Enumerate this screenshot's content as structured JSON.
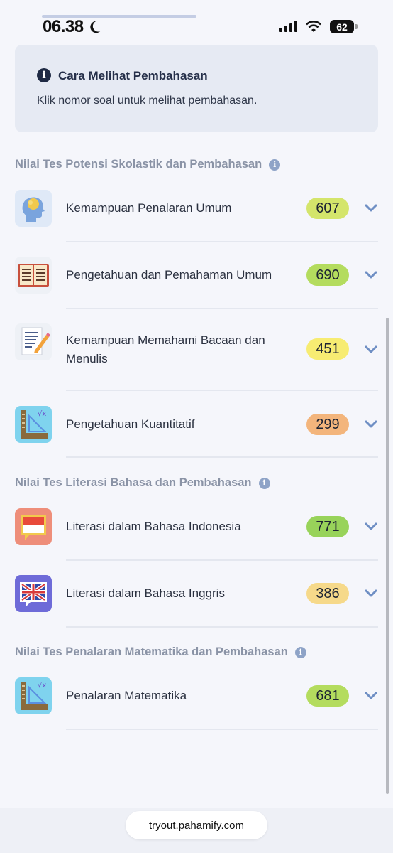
{
  "status_bar": {
    "time": "06.38",
    "battery": "62"
  },
  "info_box": {
    "title": "Cara Melihat Pembahasan",
    "text": "Klik nomor soal untuk melihat pembahasan."
  },
  "sections": [
    {
      "heading": "Nilai Tes Potensi Skolastik dan Pembahasan",
      "items": [
        {
          "label": "Kemampuan Penalaran Umum",
          "score": "607",
          "icon": "head-brain-icon",
          "score_color": "#d4e56b"
        },
        {
          "label": "Pengetahuan dan Pemahaman Umum",
          "score": "690",
          "icon": "open-book-icon",
          "score_color": "#b4dc5e"
        },
        {
          "label": "Kemampuan Memahami Bacaan dan Menulis",
          "score": "451",
          "icon": "document-pencil-icon",
          "score_color": "#f7ec72"
        },
        {
          "label": "Pengetahuan Kuantitatif",
          "score": "299",
          "icon": "ruler-math-icon",
          "score_color": "#f3b57c"
        }
      ]
    },
    {
      "heading": "Nilai Tes Literasi Bahasa dan Pembahasan",
      "items": [
        {
          "label": "Literasi dalam Bahasa Indonesia",
          "score": "771",
          "icon": "indonesia-flag-chat-icon",
          "score_color": "#98d35a"
        },
        {
          "label": "Literasi dalam Bahasa Inggris",
          "score": "386",
          "icon": "uk-flag-chat-icon",
          "score_color": "#f6d98a"
        }
      ]
    },
    {
      "heading": "Nilai Tes Penalaran Matematika dan Pembahasan",
      "items": [
        {
          "label": "Penalaran Matematika",
          "score": "681",
          "icon": "ruler-math-icon",
          "score_color": "#b4dc5e"
        }
      ]
    }
  ],
  "browser": {
    "url": "tryout.pahamify.com"
  }
}
